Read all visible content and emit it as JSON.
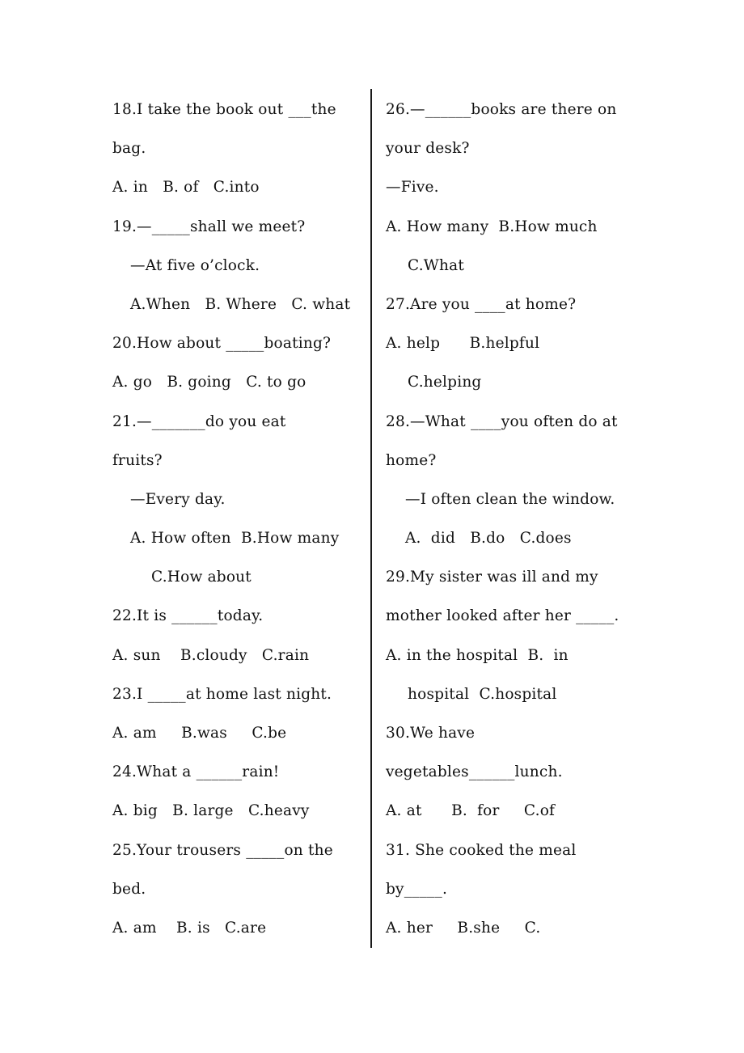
{
  "left_column": {
    "lines": [
      {
        "text": "18.I take the book out ___the",
        "indent": 0
      },
      {
        "text": "bag.",
        "indent": 0
      },
      {
        "text": "A. in   B. of   C.into",
        "indent": 0
      },
      {
        "text": "19.—_____shall we meet?",
        "indent": 0
      },
      {
        "text": "—At five o’clock.",
        "indent": 1
      },
      {
        "text": "A.When   B. Where   C. what",
        "indent": 1
      },
      {
        "text": "20.How about _____boating?",
        "indent": 0
      },
      {
        "text": "A. go   B. going   C. to go",
        "indent": 0
      },
      {
        "text": "21.—_______do you eat",
        "indent": 0
      },
      {
        "text": "fruits?",
        "indent": 0
      },
      {
        "text": "—Every day.",
        "indent": 1
      },
      {
        "text": "A. How often  B.How many",
        "indent": 1
      },
      {
        "text": "C.How about",
        "indent": 2
      },
      {
        "text": "22.It is ______today.",
        "indent": 0
      },
      {
        "text": "A. sun    B.cloudy   C.rain",
        "indent": 0
      },
      {
        "text": "23.I _____at home last night.",
        "indent": 0
      },
      {
        "text": "A. am     B.was     C.be",
        "indent": 0
      },
      {
        "text": "24.What a ______rain!",
        "indent": 0
      },
      {
        "text": "A. big   B. large   C.heavy",
        "indent": 0
      },
      {
        "text": "25.Your trousers _____on the",
        "indent": 0
      },
      {
        "text": "bed.",
        "indent": 0
      },
      {
        "text": "A. am    B. is   C.are",
        "indent": 0
      }
    ]
  },
  "right_column": {
    "lines": [
      {
        "text": "26.—______books are there on",
        "indent": 0
      },
      {
        "text": "your desk?",
        "indent": 0
      },
      {
        "text": "—Five.",
        "indent": 0
      },
      {
        "text": "A. How many  B.How much",
        "indent": 0
      },
      {
        "text": "C.What",
        "indent": 2
      },
      {
        "text": "27.Are you ____at home?",
        "indent": 0
      },
      {
        "text": "A. help      B.helpful",
        "indent": 0
      },
      {
        "text": "C.helping",
        "indent": 2
      },
      {
        "text": "28.—What ____you often do at",
        "indent": 0
      },
      {
        "text": "home?",
        "indent": 0
      },
      {
        "text": "—I often clean the window.",
        "indent": 1
      },
      {
        "text": "A.  did   B.do   C.does",
        "indent": 1
      },
      {
        "text": "29.My sister was ill and my",
        "indent": 0
      },
      {
        "text": "mother looked after her _____.",
        "indent": 0
      },
      {
        "text": "A. in the hospital  B.  in",
        "indent": 0
      },
      {
        "text": "hospital  C.hospital",
        "indent": 2
      },
      {
        "text": "30.We have",
        "indent": 0
      },
      {
        "text": "vegetables______lunch.",
        "indent": 0
      },
      {
        "text": "A. at      B.  for     C.of",
        "indent": 0
      },
      {
        "text": "31. She cooked the meal",
        "indent": 0
      },
      {
        "text": "by_____.",
        "indent": 0
      },
      {
        "text": "A. her     B.she     C.",
        "indent": 0
      }
    ]
  }
}
